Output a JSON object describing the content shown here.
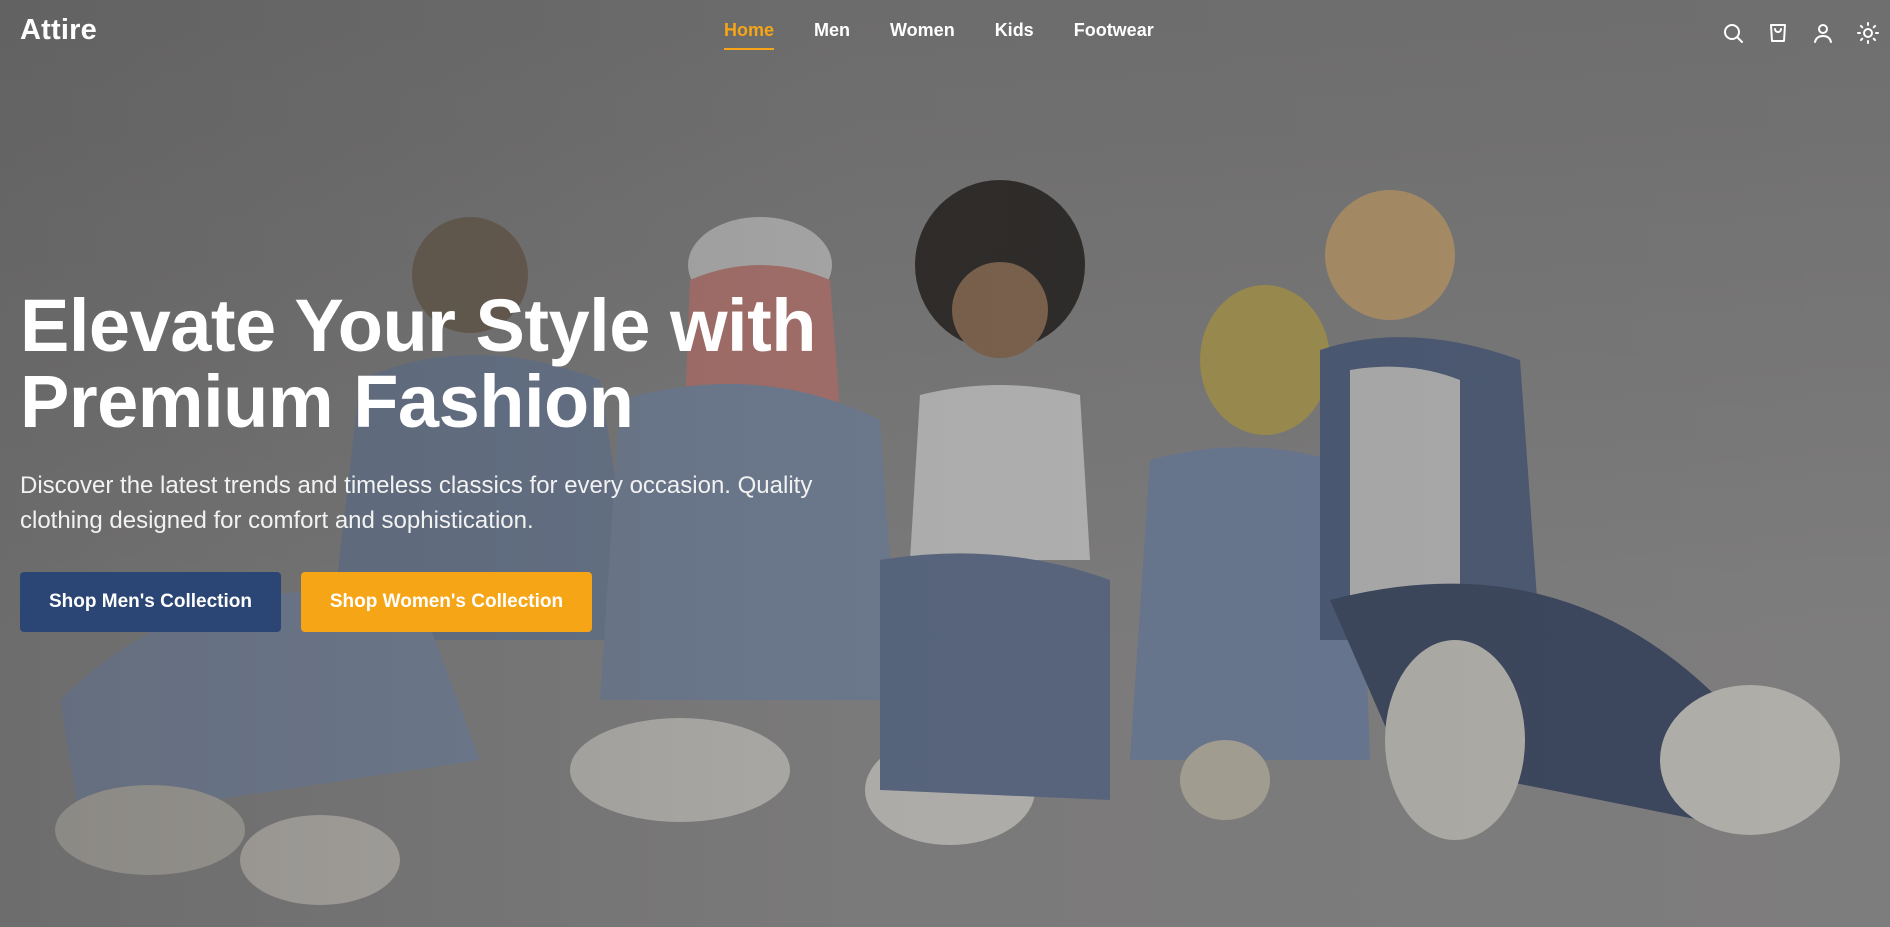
{
  "brand": {
    "logo": "Attire"
  },
  "nav": {
    "items": [
      {
        "label": "Home",
        "active": true
      },
      {
        "label": "Men",
        "active": false
      },
      {
        "label": "Women",
        "active": false
      },
      {
        "label": "Kids",
        "active": false
      },
      {
        "label": "Footwear",
        "active": false
      }
    ]
  },
  "header_icons": [
    "search-icon",
    "cart-icon",
    "user-icon",
    "theme-toggle-icon"
  ],
  "hero": {
    "title_line1": "Elevate Your Style with",
    "title_line2": "Premium Fashion",
    "subtitle": "Discover the latest trends and timeless classics for every occasion. Quality clothing designed for comfort and sophistication.",
    "cta_primary": "Shop Men's Collection",
    "cta_secondary": "Shop Women's Collection"
  },
  "colors": {
    "accent": "#f5a516",
    "primary_button": "#2b4574",
    "text": "#ffffff"
  }
}
